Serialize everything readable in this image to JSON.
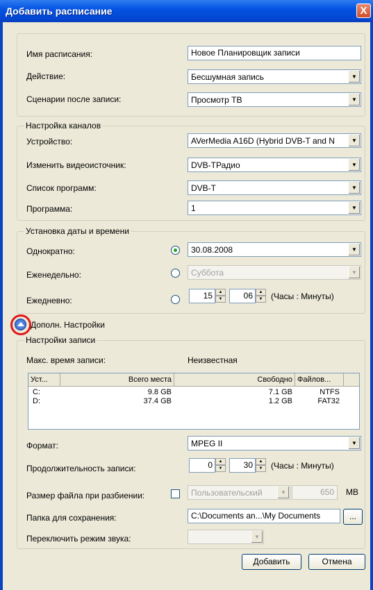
{
  "window": {
    "title": "Добавить расписание",
    "close_label": "X"
  },
  "general": {
    "name_label": "Имя расписания:",
    "name_value": "Новое Планировщик записи",
    "action_label": "Действие:",
    "action_value": "Бесшумная запись",
    "after_label": "Сценарии после записи:",
    "after_value": "Просмотр ТВ"
  },
  "channels": {
    "legend": "Настройка каналов",
    "device_label": "Устройство:",
    "device_value": "AVerMedia A16D (Hybrid DVB-T and N",
    "source_label": "Изменить видеоисточник:",
    "source_value": "DVB-TРадио",
    "list_label": "Список программ:",
    "list_value": "DVB-T",
    "program_label": "Программа:",
    "program_value": "1"
  },
  "datetime": {
    "legend": "Установка даты и времени",
    "once_label": "Однократно:",
    "once_value": "30.08.2008",
    "weekly_label": "Еженедельно:",
    "weekly_value": "Суббота",
    "daily_label": "Ежедневно:",
    "daily_hours": "15",
    "daily_minutes": "06",
    "daily_units": "(Часы : Минуты)"
  },
  "advanced": {
    "label": "Дополн. Настройки"
  },
  "recording": {
    "legend": "Настройки записи",
    "max_label": "Макс. время записи:",
    "max_value": "Неизвестная",
    "columns": [
      "Уст...",
      "Всего места",
      "Свободно",
      "Файлов..."
    ],
    "rows": [
      {
        "drive": "C:",
        "total": "9.8 GB",
        "free": "7.1 GB",
        "fs": "NTFS"
      },
      {
        "drive": "D:",
        "total": "37.4 GB",
        "free": "1.2 GB",
        "fs": "FAT32"
      }
    ],
    "format_label": "Формат:",
    "format_value": "MPEG II",
    "duration_label": "Продолжительность записи:",
    "duration_hours": "0",
    "duration_minutes": "30",
    "duration_units": "(Часы : Минуты)",
    "split_label": "Размер файла при разбиении:",
    "split_mode": "Пользовательский",
    "split_size": "650",
    "split_unit": "MB",
    "folder_label": "Папка для сохранения:",
    "folder_value": "C:\\Documents an...\\My Documents",
    "browse_label": "...",
    "audio_label": "Переключить режим звука:"
  },
  "buttons": {
    "add": "Добавить",
    "cancel": "Отмена"
  }
}
